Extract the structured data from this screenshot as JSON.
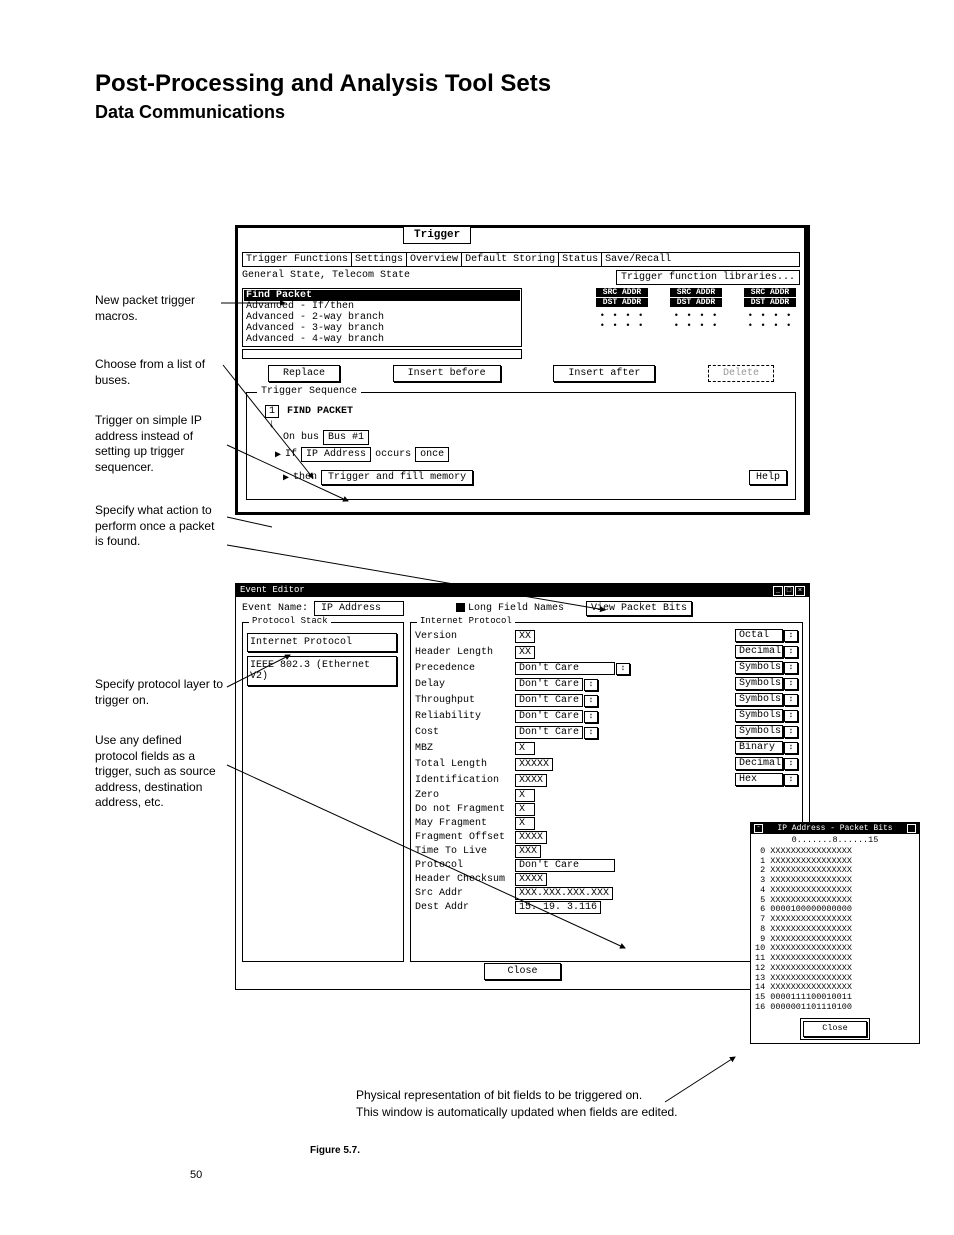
{
  "header": {
    "title": "Post-Processing and Analysis Tool Sets",
    "subtitle": "Data Communications"
  },
  "annotations": {
    "a1": "New packet trigger macros.",
    "a2": "Choose from a list of buses.",
    "a3": "Trigger on simple IP address instead of setting up trigger sequencer.",
    "a4": "Specify what action to perform once a packet is found.",
    "a5": "Specify protocol layer to trigger on.",
    "a6": "Use any defined protocol fields as a trigger, such as source address, destination address, etc."
  },
  "trigger_win": {
    "tab": "Trigger",
    "tabs": [
      "Trigger Functions",
      "Settings",
      "Overview",
      "Default Storing",
      "Status",
      "Save/Recall"
    ],
    "state_label": "General State, Telecom State",
    "lib_btn": "Trigger function libraries...",
    "list": {
      "selected": "Find Packet",
      "items": [
        "Advanced - If/then",
        "Advanced - 2-way branch",
        "Advanced - 3-way branch",
        "Advanced - 4-way branch"
      ]
    },
    "thumbs": {
      "src": "SRC ADDR",
      "dst": "DST ADDR"
    },
    "buttons": {
      "replace": "Replace",
      "before": "Insert before",
      "after": "Insert after",
      "delete": "Delete"
    },
    "seq": {
      "legend": "Trigger Sequence",
      "step_num": "1",
      "step_label": "FIND PACKET",
      "on_bus": "On bus",
      "bus_val": "Bus #1",
      "if": "If",
      "ip": "IP Address",
      "occurs": "occurs",
      "once": "once",
      "then": "then",
      "action": "Trigger and fill memory",
      "help": "Help"
    }
  },
  "event_win": {
    "title": "Event Editor",
    "name_label": "Event Name:",
    "name_value": "IP Address",
    "long_fields": "Long Field Names",
    "view_bits": "View Packet Bits",
    "proto_stack_legend": "Protocol Stack",
    "proto_items": [
      "Internet Protocol",
      "IEEE 802.3 (Ethernet V2)"
    ],
    "ip_legend": "Internet Protocol",
    "fields": [
      {
        "l": "Version",
        "v": "XX",
        "r": "Octal",
        "dd": true
      },
      {
        "l": "Header Length",
        "v": "XX",
        "r": "Decimal",
        "dd": true
      },
      {
        "l": "Precedence",
        "v": "Don't Care",
        "r": "Symbols",
        "dd": true,
        "wide": true
      },
      {
        "l": "Delay",
        "v": "Don't Care",
        "r": "Symbols",
        "dd": true
      },
      {
        "l": "Throughput",
        "v": "Don't Care",
        "r": "Symbols",
        "dd": true
      },
      {
        "l": "Reliability",
        "v": "Don't Care",
        "r": "Symbols",
        "dd": true
      },
      {
        "l": "Cost",
        "v": "Don't Care",
        "r": "Symbols",
        "dd": true
      },
      {
        "l": "MBZ",
        "v": "X",
        "r": "Binary",
        "dd": true
      },
      {
        "l": "Total Length",
        "v": "XXXXX",
        "r": "Decimal",
        "dd": true
      },
      {
        "l": "Identification",
        "v": "XXXX",
        "r": "Hex",
        "dd": true
      },
      {
        "l": "Zero",
        "v": "X",
        "r": "",
        "dd": false
      },
      {
        "l": "Do not Fragment",
        "v": "X",
        "r": "",
        "dd": false
      },
      {
        "l": "May Fragment",
        "v": "X",
        "r": "",
        "dd": false
      },
      {
        "l": "Fragment Offset",
        "v": "XXXX",
        "r": "",
        "dd": false
      },
      {
        "l": "Time To Live",
        "v": "XXX",
        "r": "",
        "dd": false
      },
      {
        "l": "Protocol",
        "v": "Don't Care",
        "r": "",
        "dd": false,
        "wide": true
      },
      {
        "l": "Header Checksum",
        "v": "XXXX",
        "r": "",
        "dd": false
      },
      {
        "l": "Src  Addr",
        "v": "XXX.XXX.XXX.XXX",
        "r": "",
        "dd": false
      },
      {
        "l": "Dest Addr",
        "v": " 15. 19.  3.116",
        "r": "",
        "dd": false
      }
    ],
    "close": "Close"
  },
  "packet_bits": {
    "title": "IP Address - Packet Bits",
    "header": "0.......8......15",
    "rows": [
      "0 XXXXXXXXXXXXXXXX",
      "1 XXXXXXXXXXXXXXXX",
      "2 XXXXXXXXXXXXXXXX",
      "3 XXXXXXXXXXXXXXXX",
      "4 XXXXXXXXXXXXXXXX",
      "5 XXXXXXXXXXXXXXXX",
      "6 0000100000000000",
      "7 XXXXXXXXXXXXXXXX",
      "8 XXXXXXXXXXXXXXXX",
      "9 XXXXXXXXXXXXXXXX",
      "10 XXXXXXXXXXXXXXXX",
      "11 XXXXXXXXXXXXXXXX",
      "12 XXXXXXXXXXXXXXXX",
      "13 XXXXXXXXXXXXXXXX",
      "14 XXXXXXXXXXXXXXXX",
      "15 0000111100010011",
      "16 0000001101110100"
    ],
    "close": "Close"
  },
  "below_caption_1": "Physical representation of bit fields to be triggered on.",
  "below_caption_2": "This window is automatically updated when fields are edited.",
  "figure_caption": "Figure 5.7.",
  "page_number": "50"
}
